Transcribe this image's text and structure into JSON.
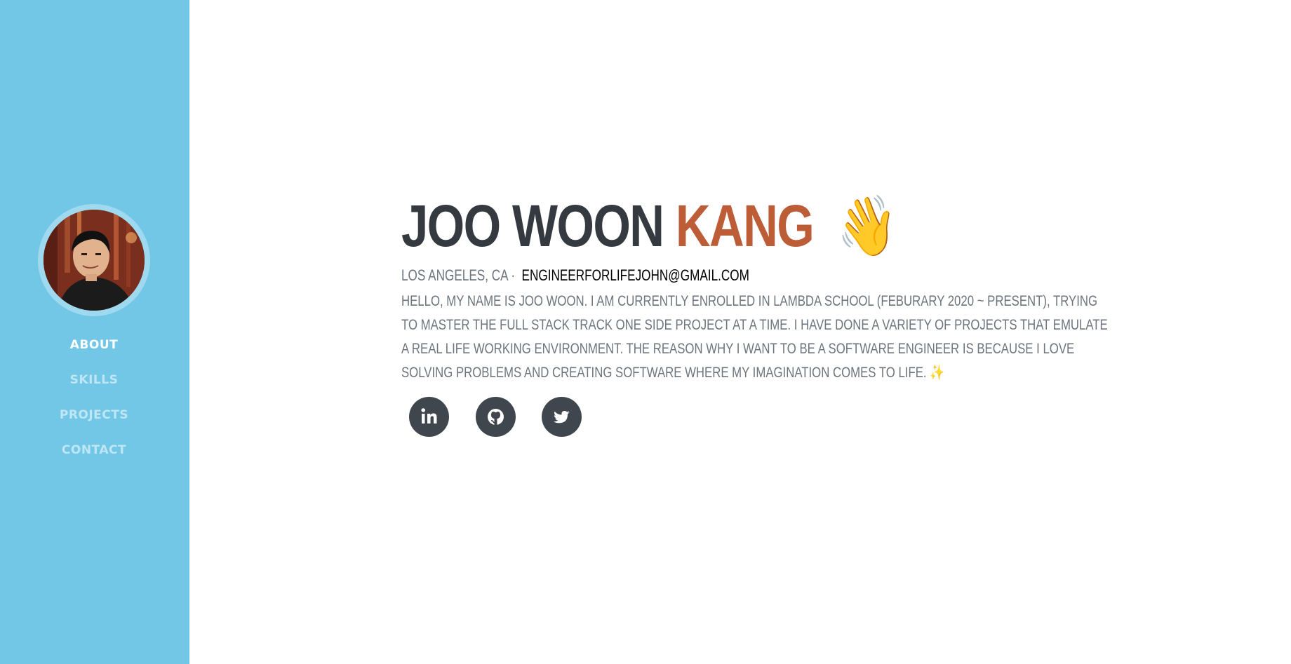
{
  "sidebar": {
    "avatar_icon": "profile-photo",
    "nav": [
      {
        "label": "ABOUT",
        "active": true
      },
      {
        "label": "SKILLS",
        "active": false
      },
      {
        "label": "PROJECTS",
        "active": false
      },
      {
        "label": "CONTACT",
        "active": false
      }
    ]
  },
  "header": {
    "first_name": "JOO WOON",
    "last_name": "KANG",
    "wave_emoji": "👋"
  },
  "subheading": {
    "location": "LOS ANGELES, CA ·",
    "email": "ENGINEERFORLIFEJOHN@GMAIL.COM"
  },
  "bio": "Hello, my name is Joo Woon. I am currently enrolled in Lambda School (Feburary 2020 ~ Present), trying to master the full stack track one side project at a time. I have done a variety of projects that emulate a real life working environment. The reason why I want to be a software engineer is because I love solving problems and creating software where my imagination comes to life. ✨",
  "social": [
    {
      "name": "linkedin",
      "icon": "linkedin-icon"
    },
    {
      "name": "github",
      "icon": "github-icon"
    },
    {
      "name": "twitter",
      "icon": "twitter-icon"
    }
  ],
  "colors": {
    "sidebar_bg": "#72c7e7",
    "accent": "#bd5d38",
    "heading": "#343a40",
    "body_text": "#6c757d",
    "social_bg": "#3f464d"
  }
}
